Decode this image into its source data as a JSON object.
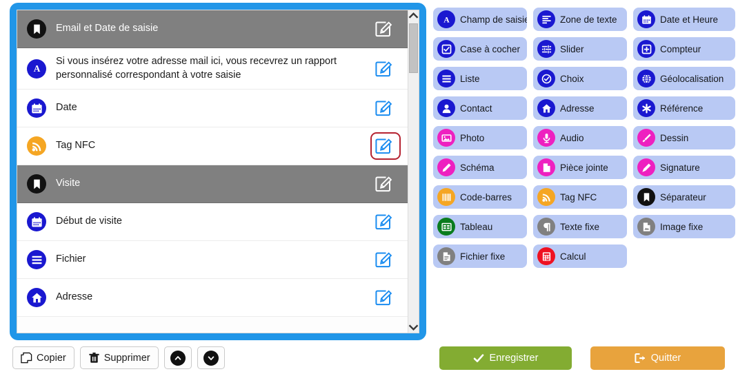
{
  "form": {
    "rows": [
      {
        "type": "group",
        "label": "Email et Date de saisie",
        "icon": "bookmark-icon",
        "icon_color": "#111111",
        "required": "none"
      },
      {
        "type": "field",
        "label": "Si vous insérez votre adresse mail ici, vous recevrez un rapport personnalisé correspondant à votre saisie",
        "icon": "text-field-icon",
        "icon_color": "#1a18d0",
        "required": "optional"
      },
      {
        "type": "field",
        "label": "Date",
        "icon": "calendar-icon",
        "icon_color": "#1a18d0",
        "required": "optional"
      },
      {
        "type": "field",
        "label": "Tag NFC",
        "icon": "nfc-icon",
        "icon_color": "#f5a623",
        "required": "optional",
        "highlighted": true
      },
      {
        "type": "group",
        "label": "Visite",
        "icon": "bookmark-icon",
        "icon_color": "#111111",
        "required": "none"
      },
      {
        "type": "field",
        "label": "Début de visite",
        "icon": "calendar-icon",
        "icon_color": "#1a18d0",
        "required": "optional"
      },
      {
        "type": "field",
        "label": "Fichier",
        "icon": "list-icon",
        "icon_color": "#1a18d0",
        "required": "optional"
      },
      {
        "type": "field",
        "label": "Adresse",
        "icon": "home-icon",
        "icon_color": "#1a18d0",
        "required": "mandatory"
      }
    ],
    "edit_icon": "edit-pencil-icon",
    "required_marker": "✳",
    "mandatory_marker": "✳",
    "highlight_color": "#b52230",
    "group_row_color": "#808080",
    "scrollbar": {
      "up_arrow": "chevron-up-icon",
      "down_arrow": "chevron-down-icon"
    }
  },
  "toolbar": {
    "copy_label": "Copier",
    "delete_label": "Supprimer",
    "move_up_icon": "chevron-up-circle-icon",
    "move_down_icon": "chevron-down-circle-icon",
    "copy_icon": "copy-icon",
    "delete_icon": "trash-icon"
  },
  "palette": {
    "items": [
      {
        "label": "Champ de saisie",
        "icon": "text-field-icon",
        "icon_color": "#1a18d0"
      },
      {
        "label": "Zone de texte",
        "icon": "textarea-icon",
        "icon_color": "#1a18d0"
      },
      {
        "label": "Date et Heure",
        "icon": "calendar-icon",
        "icon_color": "#1a18d0"
      },
      {
        "label": "Case à cocher",
        "icon": "checkbox-icon",
        "icon_color": "#1a18d0"
      },
      {
        "label": "Slider",
        "icon": "sliders-icon",
        "icon_color": "#1a18d0"
      },
      {
        "label": "Compteur",
        "icon": "plus-square-icon",
        "icon_color": "#1a18d0"
      },
      {
        "label": "Liste",
        "icon": "list-icon",
        "icon_color": "#1a18d0"
      },
      {
        "label": "Choix",
        "icon": "check-circle-icon",
        "icon_color": "#1a18d0"
      },
      {
        "label": "Géolocalisation",
        "icon": "globe-icon",
        "icon_color": "#1a18d0"
      },
      {
        "label": "Contact",
        "icon": "user-icon",
        "icon_color": "#1a18d0"
      },
      {
        "label": "Adresse",
        "icon": "home-icon",
        "icon_color": "#1a18d0"
      },
      {
        "label": "Référence",
        "icon": "asterisk-icon",
        "icon_color": "#1a18d0"
      },
      {
        "label": "Photo",
        "icon": "photo-icon",
        "icon_color": "#ee20c0"
      },
      {
        "label": "Audio",
        "icon": "microphone-icon",
        "icon_color": "#ee20c0"
      },
      {
        "label": "Dessin",
        "icon": "paintbrush-icon",
        "icon_color": "#ee20c0"
      },
      {
        "label": "Schéma",
        "icon": "pencil-icon",
        "icon_color": "#ee20c0"
      },
      {
        "label": "Pièce jointe",
        "icon": "file-icon",
        "icon_color": "#ee20c0"
      },
      {
        "label": "Signature",
        "icon": "signature-icon",
        "icon_color": "#ee20c0"
      },
      {
        "label": "Code-barres",
        "icon": "barcode-icon",
        "icon_color": "#f5a623"
      },
      {
        "label": "Tag NFC",
        "icon": "nfc-icon",
        "icon_color": "#f5a623"
      },
      {
        "label": "Séparateur",
        "icon": "bookmark-icon",
        "icon_color": "#111111"
      },
      {
        "label": "Tableau",
        "icon": "table-icon",
        "icon_color": "#0a7c1e"
      },
      {
        "label": "Texte fixe",
        "icon": "paragraph-icon",
        "icon_color": "#808080"
      },
      {
        "label": "Image fixe",
        "icon": "file-image-icon",
        "icon_color": "#808080"
      },
      {
        "label": "Fichier fixe",
        "icon": "file-lines-icon",
        "icon_color": "#808080"
      },
      {
        "label": "Calcul",
        "icon": "calculator-icon",
        "icon_color": "#ee1122"
      }
    ]
  },
  "actions": {
    "save_label": "Enregistrer",
    "save_icon": "check-icon",
    "save_color": "#83ac32",
    "quit_label": "Quitter",
    "quit_icon": "sign-out-icon",
    "quit_color": "#e8a33d"
  }
}
